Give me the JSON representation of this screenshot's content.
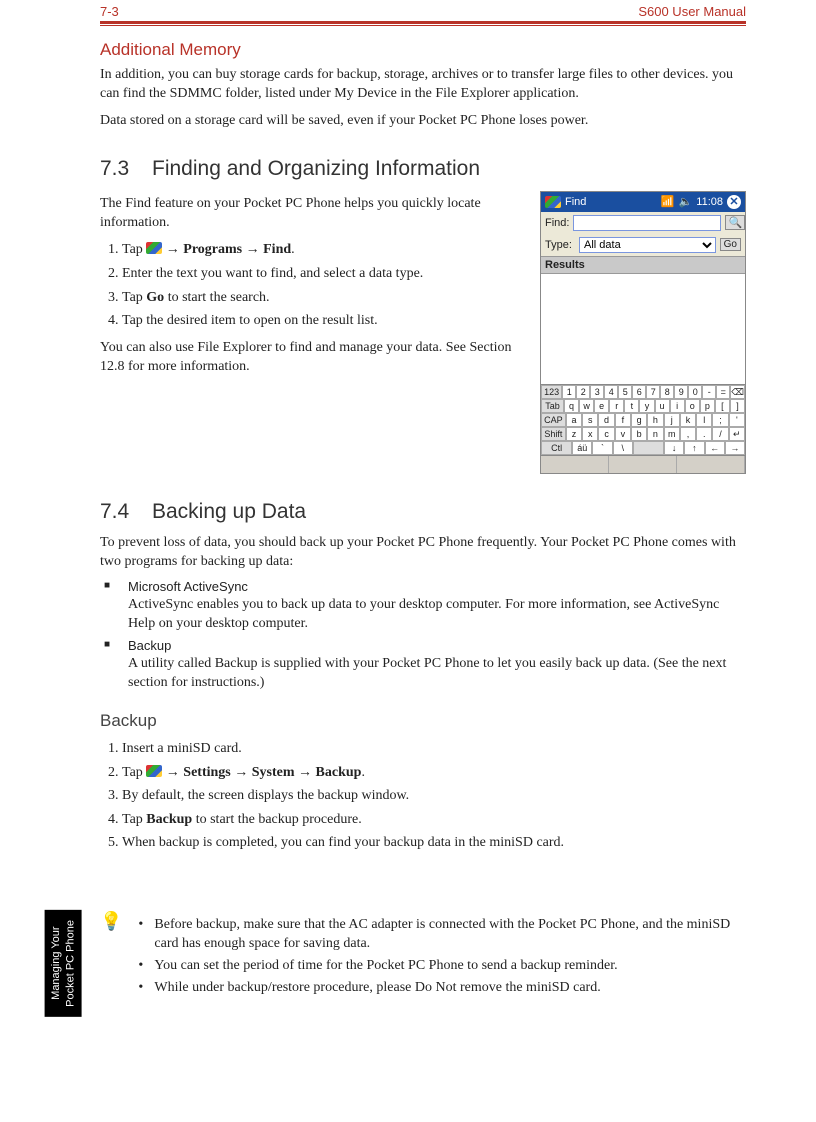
{
  "header": {
    "page_num": "7-3",
    "doc_title": "S600 User Manual"
  },
  "sidetab": "Managing Your\nPocket PC Phone",
  "s1": {
    "title": "Additional Memory",
    "p1": "In addition, you can buy storage cards for backup, storage, archives or to transfer large files to other devices. you can find the SDMMC folder, listed under My Device in the File Explorer application.",
    "p2": "Data stored on a storage card will be saved, even if your Pocket PC Phone loses power."
  },
  "s2": {
    "num": "7.3",
    "title": "Finding and Organizing Information",
    "intro": "The Find feature on your Pocket PC Phone helps you quickly locate information.",
    "steps": {
      "s1a": "Tap ",
      "s1b_path": " → Programs → Find",
      "s2": "Enter the text you want to find, and select a data type.",
      "s3a": "Tap ",
      "s3b_go": "Go",
      "s3c": " to start the search.",
      "s4": "Tap the desired item to open on the result list."
    },
    "outro": "You can also use File Explorer to find and manage your data. See Section 12.8 for more information."
  },
  "s3": {
    "num": "7.4",
    "title": "Backing up Data",
    "intro": "To prevent loss of data, you should back up your Pocket PC Phone frequently. Your Pocket PC Phone comes with two programs for backing up data:",
    "b1_title": "Microsoft ActiveSync",
    "b1_desc": "ActiveSync enables you to back up data to your desktop computer. For more information, see ActiveSync Help on your desktop computer.",
    "b2_title": "Backup",
    "b2_desc": "A utility called Backup is supplied with your Pocket PC Phone to let you easily back up data. (See the next section for instructions.)"
  },
  "s4": {
    "title": "Backup",
    "steps": {
      "s1": "Insert a miniSD card.",
      "s2a": "Tap ",
      "s2b_path": " → Settings → System → Backup",
      "s3": "By default, the screen displays the backup window.",
      "s4a": "Tap ",
      "s4b_backup": "Backup",
      "s4c": " to start the backup procedure.",
      "s5": "When backup is completed, you can find your backup data in the miniSD card."
    }
  },
  "tips": {
    "t1": "Before backup, make sure that the AC adapter is connected with the Pocket PC Phone, and the miniSD card has enough space for saving data.",
    "t2": "You can set the period of time for the Pocket PC Phone to send a backup reminder.",
    "t3": "While under backup/restore procedure, please Do Not remove the miniSD card."
  },
  "screenshot": {
    "title": "Find",
    "clock": "11:08",
    "find_label": "Find:",
    "type_label": "Type:",
    "type_value": "All data",
    "go_label": "Go",
    "results_hdr": "Results",
    "kbd": {
      "r1": [
        "123",
        "1",
        "2",
        "3",
        "4",
        "5",
        "6",
        "7",
        "8",
        "9",
        "0",
        "-",
        "=",
        "⌫"
      ],
      "r2": [
        "Tab",
        "q",
        "w",
        "e",
        "r",
        "t",
        "y",
        "u",
        "i",
        "o",
        "p",
        "[",
        "]"
      ],
      "r3": [
        "CAP",
        "a",
        "s",
        "d",
        "f",
        "g",
        "h",
        "j",
        "k",
        "l",
        ";",
        "'"
      ],
      "r4": [
        "Shift",
        "z",
        "x",
        "c",
        "v",
        "b",
        "n",
        "m",
        ",",
        ".",
        "/",
        "↵"
      ],
      "r5": [
        "Ctl",
        "áü",
        "`",
        "\\",
        " ",
        "↓",
        "↑",
        "←",
        "→"
      ]
    }
  }
}
